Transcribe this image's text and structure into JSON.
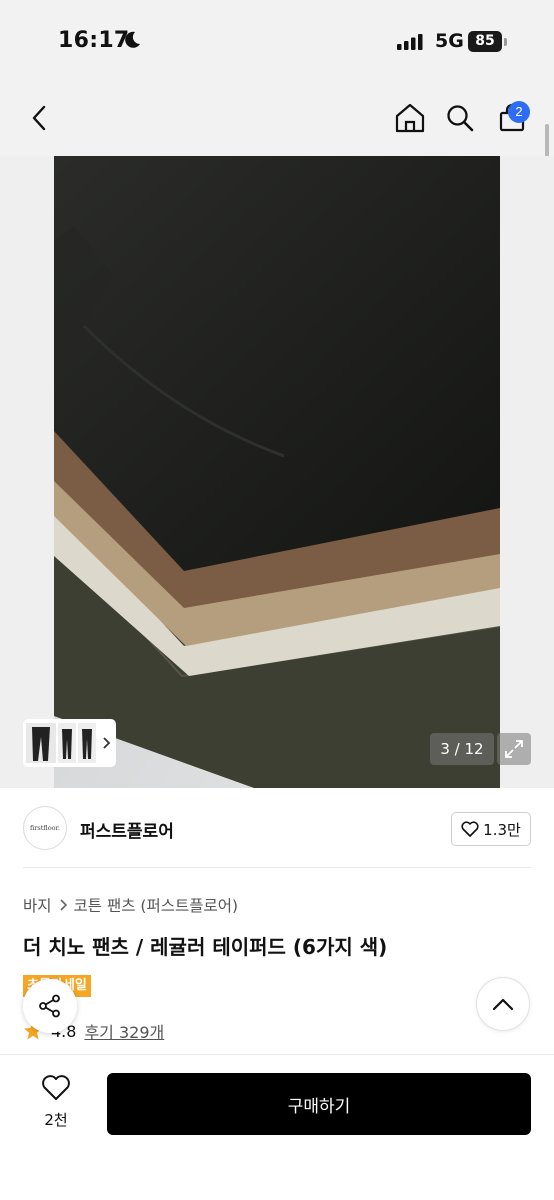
{
  "status": {
    "time": "16:17",
    "network": "5G",
    "battery": "85"
  },
  "nav": {
    "cart_count": "2"
  },
  "gallery": {
    "counter": "3 / 12"
  },
  "brand": {
    "logo_text": "firstfloor.",
    "name": "퍼스트플로어",
    "likes": "1.3만"
  },
  "breadcrumb": {
    "level1": "바지",
    "level2": "코튼 팬츠 (퍼스트플로어)"
  },
  "product": {
    "title": "더 치노 팬츠 / 레귤러 테이퍼드 (6가지 색)",
    "sale_tag": "초특가세일",
    "rating": "4.8",
    "reviews": "후기 329개"
  },
  "bottom": {
    "wish_count": "2천",
    "buy_label": "구매하기"
  },
  "colors": {
    "accent": "#2d6cf5",
    "star": "#f5a623",
    "buy_bg": "#000000"
  },
  "icons": [
    "moon-icon",
    "signal-icon",
    "back-icon",
    "home-icon",
    "search-icon",
    "cart-icon",
    "chevron-right-icon",
    "expand-icon",
    "heart-icon",
    "share-icon",
    "chevron-up-icon",
    "star-icon"
  ]
}
